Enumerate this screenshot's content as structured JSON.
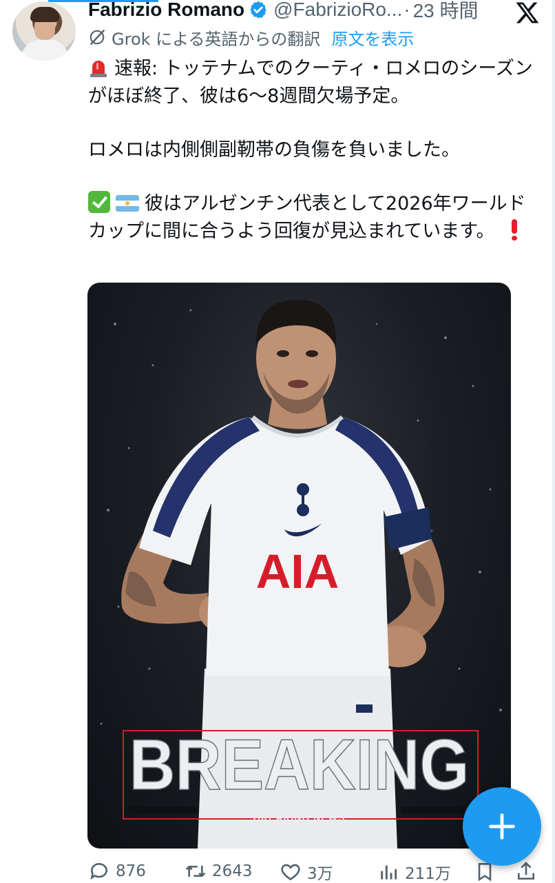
{
  "app": {
    "accent_color": "#1d9bf0"
  },
  "tweet": {
    "author": {
      "display_name": "Fabrizio Romano",
      "handle": "@FabrizioRo...",
      "time_sep": "·",
      "time": "23 時間",
      "verified": true
    },
    "translation": {
      "note": "Grok による英語からの翻訳",
      "show_original": "原文を表示"
    },
    "text": {
      "line1": "速報: トッテナムでのクーティ・ロメロのシーズンがほぼ終了、彼は6〜8週間欠場予定。",
      "line2": "ロメロは内側側副靭帯の負傷を負いました。",
      "line3": "彼はアルゼンチン代表として2026年ワールドカップに間に合うよう回復が見込まれています。"
    },
    "media": {
      "headline": "BREAKING",
      "subline": "BREAKING NEWS",
      "shirt_sponsor": "AIA"
    },
    "stats": {
      "replies": "876",
      "reposts": "2643",
      "likes": "3万",
      "views": "211万"
    }
  },
  "icons": {
    "platform": "x-logo-icon",
    "translation": "grok-icon",
    "compose": "plus-icon",
    "reply": "reply-icon",
    "repost": "repost-icon",
    "like": "heart-icon",
    "views": "bar-chart-icon",
    "bookmark": "bookmark-icon",
    "share": "share-icon"
  }
}
